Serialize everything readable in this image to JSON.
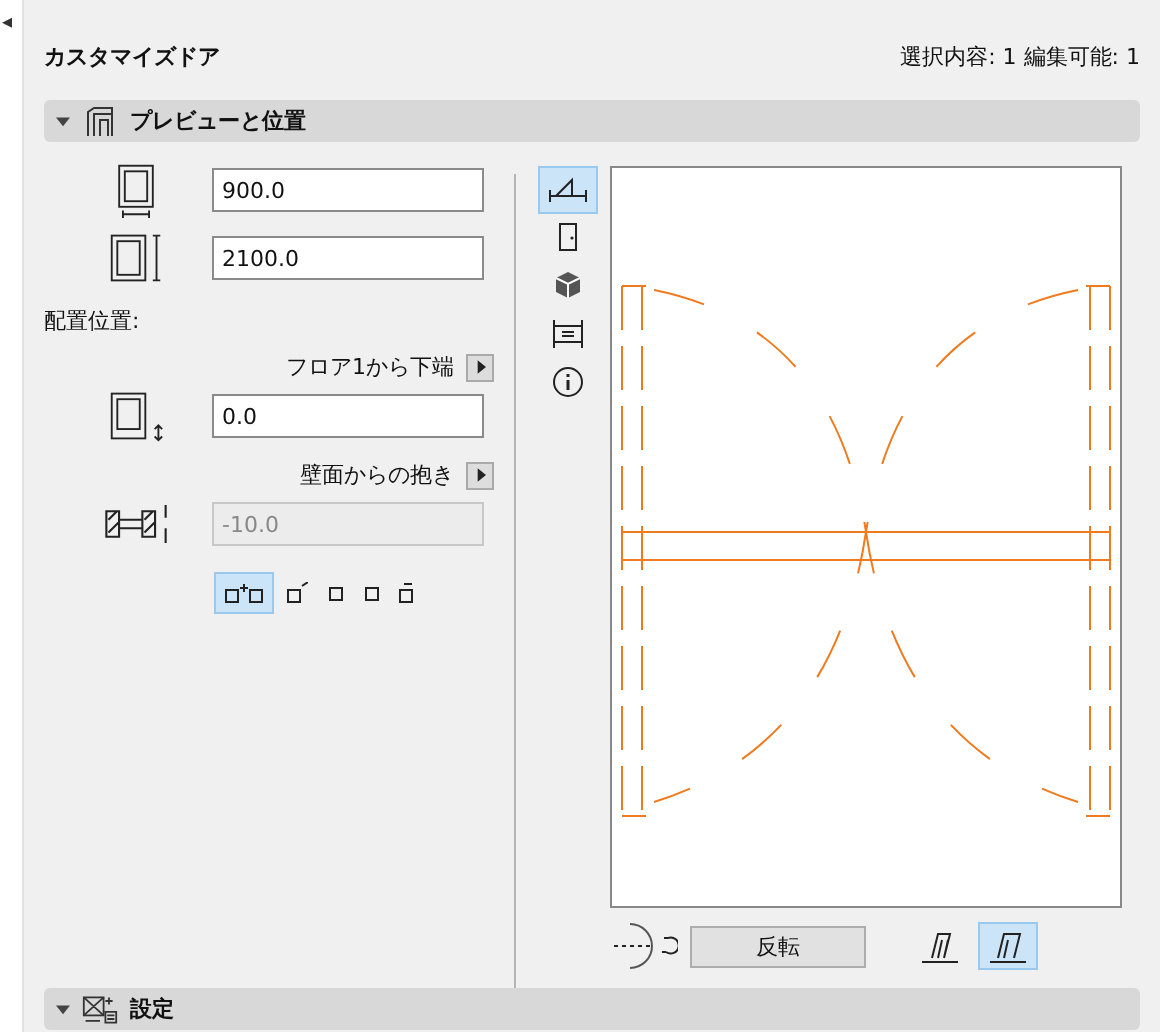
{
  "panel_toggle": "◂",
  "title": "カスタマイズドア",
  "selection_info": "選択内容: 1 編集可能: 1",
  "sections": [
    {
      "label": "プレビューと位置",
      "expanded": true
    },
    {
      "label": "設定",
      "expanded": true
    }
  ],
  "width_field": {
    "value": "900.0"
  },
  "height_field": {
    "value": "2100.0"
  },
  "placement_label": "配置位置:",
  "anchor_dropdown": {
    "label": "フロア1から下端"
  },
  "offset_field": {
    "value": "0.0"
  },
  "reveal_dropdown": {
    "label": "壁面からの抱き"
  },
  "reveal_field": {
    "value": "-10.0",
    "disabled": true
  },
  "reveal_modes": [
    {
      "selected": true
    },
    {
      "selected": false
    },
    {
      "selected": false
    },
    {
      "selected": false
    },
    {
      "selected": false
    }
  ],
  "view_buttons": [
    {
      "kind": "plan",
      "selected": true
    },
    {
      "kind": "door",
      "selected": false
    },
    {
      "kind": "cube",
      "selected": false
    },
    {
      "kind": "section",
      "selected": false
    },
    {
      "kind": "info",
      "selected": false
    }
  ],
  "flip_button": {
    "label": "反転"
  },
  "hinge_options": [
    {
      "selected": false
    },
    {
      "selected": true
    }
  ]
}
